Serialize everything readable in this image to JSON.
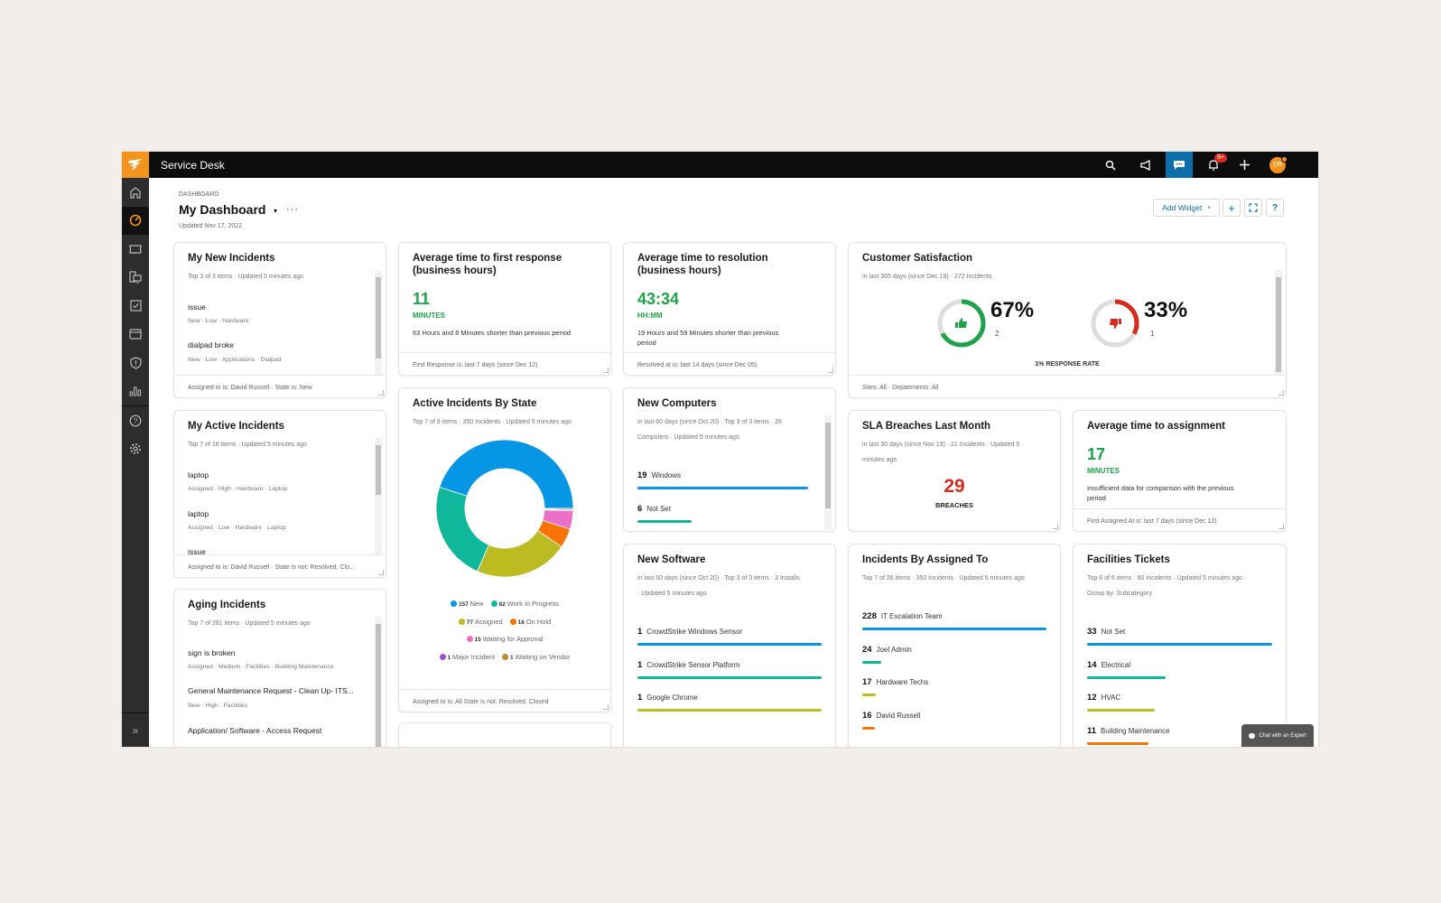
{
  "app": {
    "title": "Service Desk"
  },
  "topbar": {
    "icons": [
      "search-icon",
      "announcement-icon",
      "chat-icon",
      "bell-icon",
      "plus-icon",
      "avatar"
    ],
    "notification_badge": "9+",
    "avatar_initials": "DR",
    "accent": "#f4941c",
    "chat_active_color": "#0d6eaa"
  },
  "sidebar": {
    "items": [
      {
        "name": "home",
        "icon": "home-icon",
        "active": false
      },
      {
        "name": "dashboard",
        "icon": "gauge-icon",
        "active": true
      },
      {
        "name": "tickets",
        "icon": "ticket-icon",
        "active": false
      },
      {
        "name": "assets",
        "icon": "devices-icon",
        "active": false
      },
      {
        "name": "tasks",
        "icon": "checkbox-icon",
        "active": false
      },
      {
        "name": "service-catalog",
        "icon": "card-icon",
        "active": false
      },
      {
        "name": "security",
        "icon": "shield-icon",
        "active": false
      },
      {
        "name": "reports",
        "icon": "bar-chart-icon",
        "active": false
      },
      {
        "name": "help",
        "icon": "help-icon",
        "active": false
      },
      {
        "name": "settings",
        "icon": "gear-icon",
        "active": false
      }
    ],
    "expand_label": "»"
  },
  "header": {
    "breadcrumb": "DASHBOARD",
    "title": "My Dashboard",
    "caret": "▾",
    "more": "···",
    "updated": "Updated Nov 17, 2022",
    "add_widget_label": "Add Widget",
    "add_widget_caret": "▾",
    "plus_label": "+",
    "fullscreen_label": "⛶",
    "help_label": "?"
  },
  "widgets": {
    "my_new_incidents": {
      "title": "My New Incidents",
      "subtitle": "Top 3 of 3 items · Updated 5 minutes ago",
      "items": [
        {
          "title": "issue",
          "meta": "New · Low · Hardware"
        },
        {
          "title": "dialpad broke",
          "meta": "New · Low · Applications · Dialpad"
        }
      ],
      "footer": "Assigned to is: David Russell · State is: New"
    },
    "first_response": {
      "title_line1": "Average time to first response",
      "title_line2": "(business hours)",
      "value": "11",
      "unit": "MINUTES",
      "desc": "63 Hours and 8 Minutes shorter than previous period",
      "footer": "First Response is: last 7 days (since Dec 12)"
    },
    "resolution": {
      "title_line1": "Average time to resolution",
      "title_line2": "(business hours)",
      "value": "43:34",
      "unit": "HH:MM",
      "desc_line1": "19 Hours and 59 Minutes shorter than previous",
      "desc_line2": "period",
      "footer": "Resolved at is: last 14 days (since Dec 05)"
    },
    "csat": {
      "title": "Customer Satisfaction",
      "subtitle": "in last 365 days (since Dec 19) · 272 Incidents",
      "positive": {
        "percent_label": "67%",
        "count": "2",
        "fraction": 0.67,
        "color": "#1fa34a"
      },
      "negative": {
        "percent_label": "33%",
        "count": "1",
        "fraction": 0.33,
        "color": "#d92b1b"
      },
      "response_rate": "1% RESPONSE RATE",
      "footer": "Sites: All · Departments: All"
    },
    "my_active_incidents": {
      "title": "My Active Incidents",
      "subtitle": "Top 7 of 16 items · Updated 5 minutes ago",
      "items": [
        {
          "title": "laptop",
          "meta": "Assigned · High · Hardware · Laptop"
        },
        {
          "title": "laptop",
          "meta": "Assigned · Low · Hardware · Laptop"
        },
        {
          "title": "issue",
          "meta": ""
        }
      ],
      "footer": "Assigned to is: David Russell · State is not: Resolved, Clo..."
    },
    "active_by_state": {
      "title": "Active Incidents By State",
      "subtitle": "Top 7 of 8 items · 350 Incidents · Updated 5 minutes ago",
      "footer": "Assigned to is: All   State is not: Resolved, Closed"
    },
    "new_computers": {
      "title": "New Computers",
      "subtitle_line1": "in last 60 days (since Oct 20) · Top 3 of 3 items · 26",
      "subtitle_line2": "Computers · Updated 5 minutes ago",
      "max": 19,
      "bars": [
        {
          "value": 19,
          "label": "Windows",
          "color": "#0795e6"
        },
        {
          "value": 6,
          "label": "Not Set",
          "color": "#0fb89a"
        }
      ]
    },
    "sla_breaches": {
      "title": "SLA Breaches Last Month",
      "subtitle_line1": "in last 30 days (since Nov 19) · 21 Incidents · Updated 5",
      "subtitle_line2": "minutes ago",
      "value": "29",
      "unit": "BREACHES"
    },
    "time_to_assignment": {
      "title": "Average time to assignment",
      "value": "17",
      "unit": "MINUTES",
      "desc_line1": "Insufficient data for comparison with the previous",
      "desc_line2": "period",
      "footer": "First Assigned At is: last 7 days (since Dec 12)"
    },
    "aging_incidents": {
      "title": "Aging Incidents",
      "subtitle": "Top 7 of 281 items · Updated 5 minutes ago",
      "items": [
        {
          "title": "sign is broken",
          "meta": "Assigned · Medium · Facilities · Building Maintenance"
        },
        {
          "title": "General Maintenance Request - Clean Up- ITS...",
          "meta": "New · High · Facilities"
        },
        {
          "title": "Application/ Software - Access Request",
          "meta": ""
        }
      ]
    },
    "new_software": {
      "title": "New Software",
      "subtitle_line1": "in last 60 days (since Oct 20) · Top 3 of 3 items · 3 Installs",
      "subtitle_line2": " · Updated 5 minutes ago",
      "max": 1,
      "bars": [
        {
          "value": 1,
          "label": "CrowdStrike Windows Sensor",
          "color": "#0795e6"
        },
        {
          "value": 1,
          "label": "CrowdStrike Sensor Platform",
          "color": "#0fb89a"
        },
        {
          "value": 1,
          "label": "Google Chrome",
          "color": "#bcbc22"
        }
      ]
    },
    "by_assigned_to": {
      "title": "Incidents By Assigned To",
      "subtitle": "Top 7 of 26 items · 350 Incidents · Updated 5 minutes ago",
      "max": 228,
      "bars": [
        {
          "value": 228,
          "label": "IT Escalation Team",
          "color": "#0795e6"
        },
        {
          "value": 24,
          "label": "Joel Admin",
          "color": "#0fb89a"
        },
        {
          "value": 17,
          "label": "Hardware Techs",
          "color": "#bcbc22"
        },
        {
          "value": 16,
          "label": "David Russell",
          "color": "#f97306"
        }
      ]
    },
    "facilities_tickets": {
      "title": "Facilities Tickets",
      "subtitle_line1": "Top 6 of 6 items · 80 Incidents · Updated 5 minutes ago ·",
      "subtitle_line2": "Group by: Subcategory",
      "max": 33,
      "bars": [
        {
          "value": 33,
          "label": "Not Set",
          "color": "#0795e6"
        },
        {
          "value": 14,
          "label": "Electrical",
          "color": "#0fb89a"
        },
        {
          "value": 12,
          "label": "HVAC",
          "color": "#bcbc22"
        },
        {
          "value": 11,
          "label": "Building Maintenance",
          "color": "#f97306"
        }
      ]
    }
  },
  "chat_expert": {
    "label": "Chat with an Expert"
  },
  "chart_data": {
    "type": "pie",
    "title": "Active Incidents By State",
    "categories": [
      "New",
      "Work in Progress",
      "Assigned",
      "On Hold",
      "Waiting for Approval",
      "Major Incident",
      "Waiting on Vendor"
    ],
    "values": [
      157,
      82,
      77,
      16,
      15,
      1,
      1
    ],
    "colors": [
      "#0795e6",
      "#0fb89a",
      "#bcbc22",
      "#f97306",
      "#ec70c6",
      "#9b4fd6",
      "#c08a2e"
    ],
    "legend": "bottom",
    "donut": true
  }
}
